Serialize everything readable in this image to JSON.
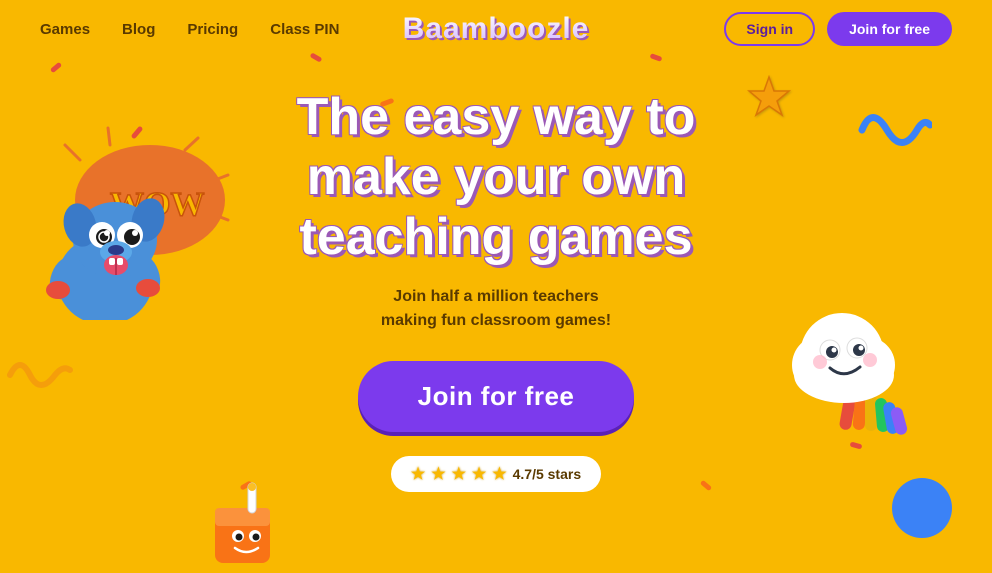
{
  "navbar": {
    "links": [
      {
        "id": "games",
        "label": "Games"
      },
      {
        "id": "blog",
        "label": "Blog"
      },
      {
        "id": "pricing",
        "label": "Pricing"
      },
      {
        "id": "class-pin",
        "label": "Class PIN"
      }
    ],
    "logo": "Baamboozle",
    "signin_label": "Sign in",
    "join_label": "Join for free"
  },
  "hero": {
    "title": "The easy way to make your own teaching games",
    "subtitle_line1": "Join half a million teachers",
    "subtitle_line2": "making fun classroom games!",
    "join_button": "Join for free",
    "stars_rating": "4.7/5 stars",
    "stars_full": 4,
    "stars_partial": 1
  },
  "colors": {
    "background": "#F9B800",
    "primary_purple": "#7c3aed",
    "dark_purple": "#5b21b6",
    "text_dark": "#5a3a00",
    "white": "#ffffff"
  }
}
